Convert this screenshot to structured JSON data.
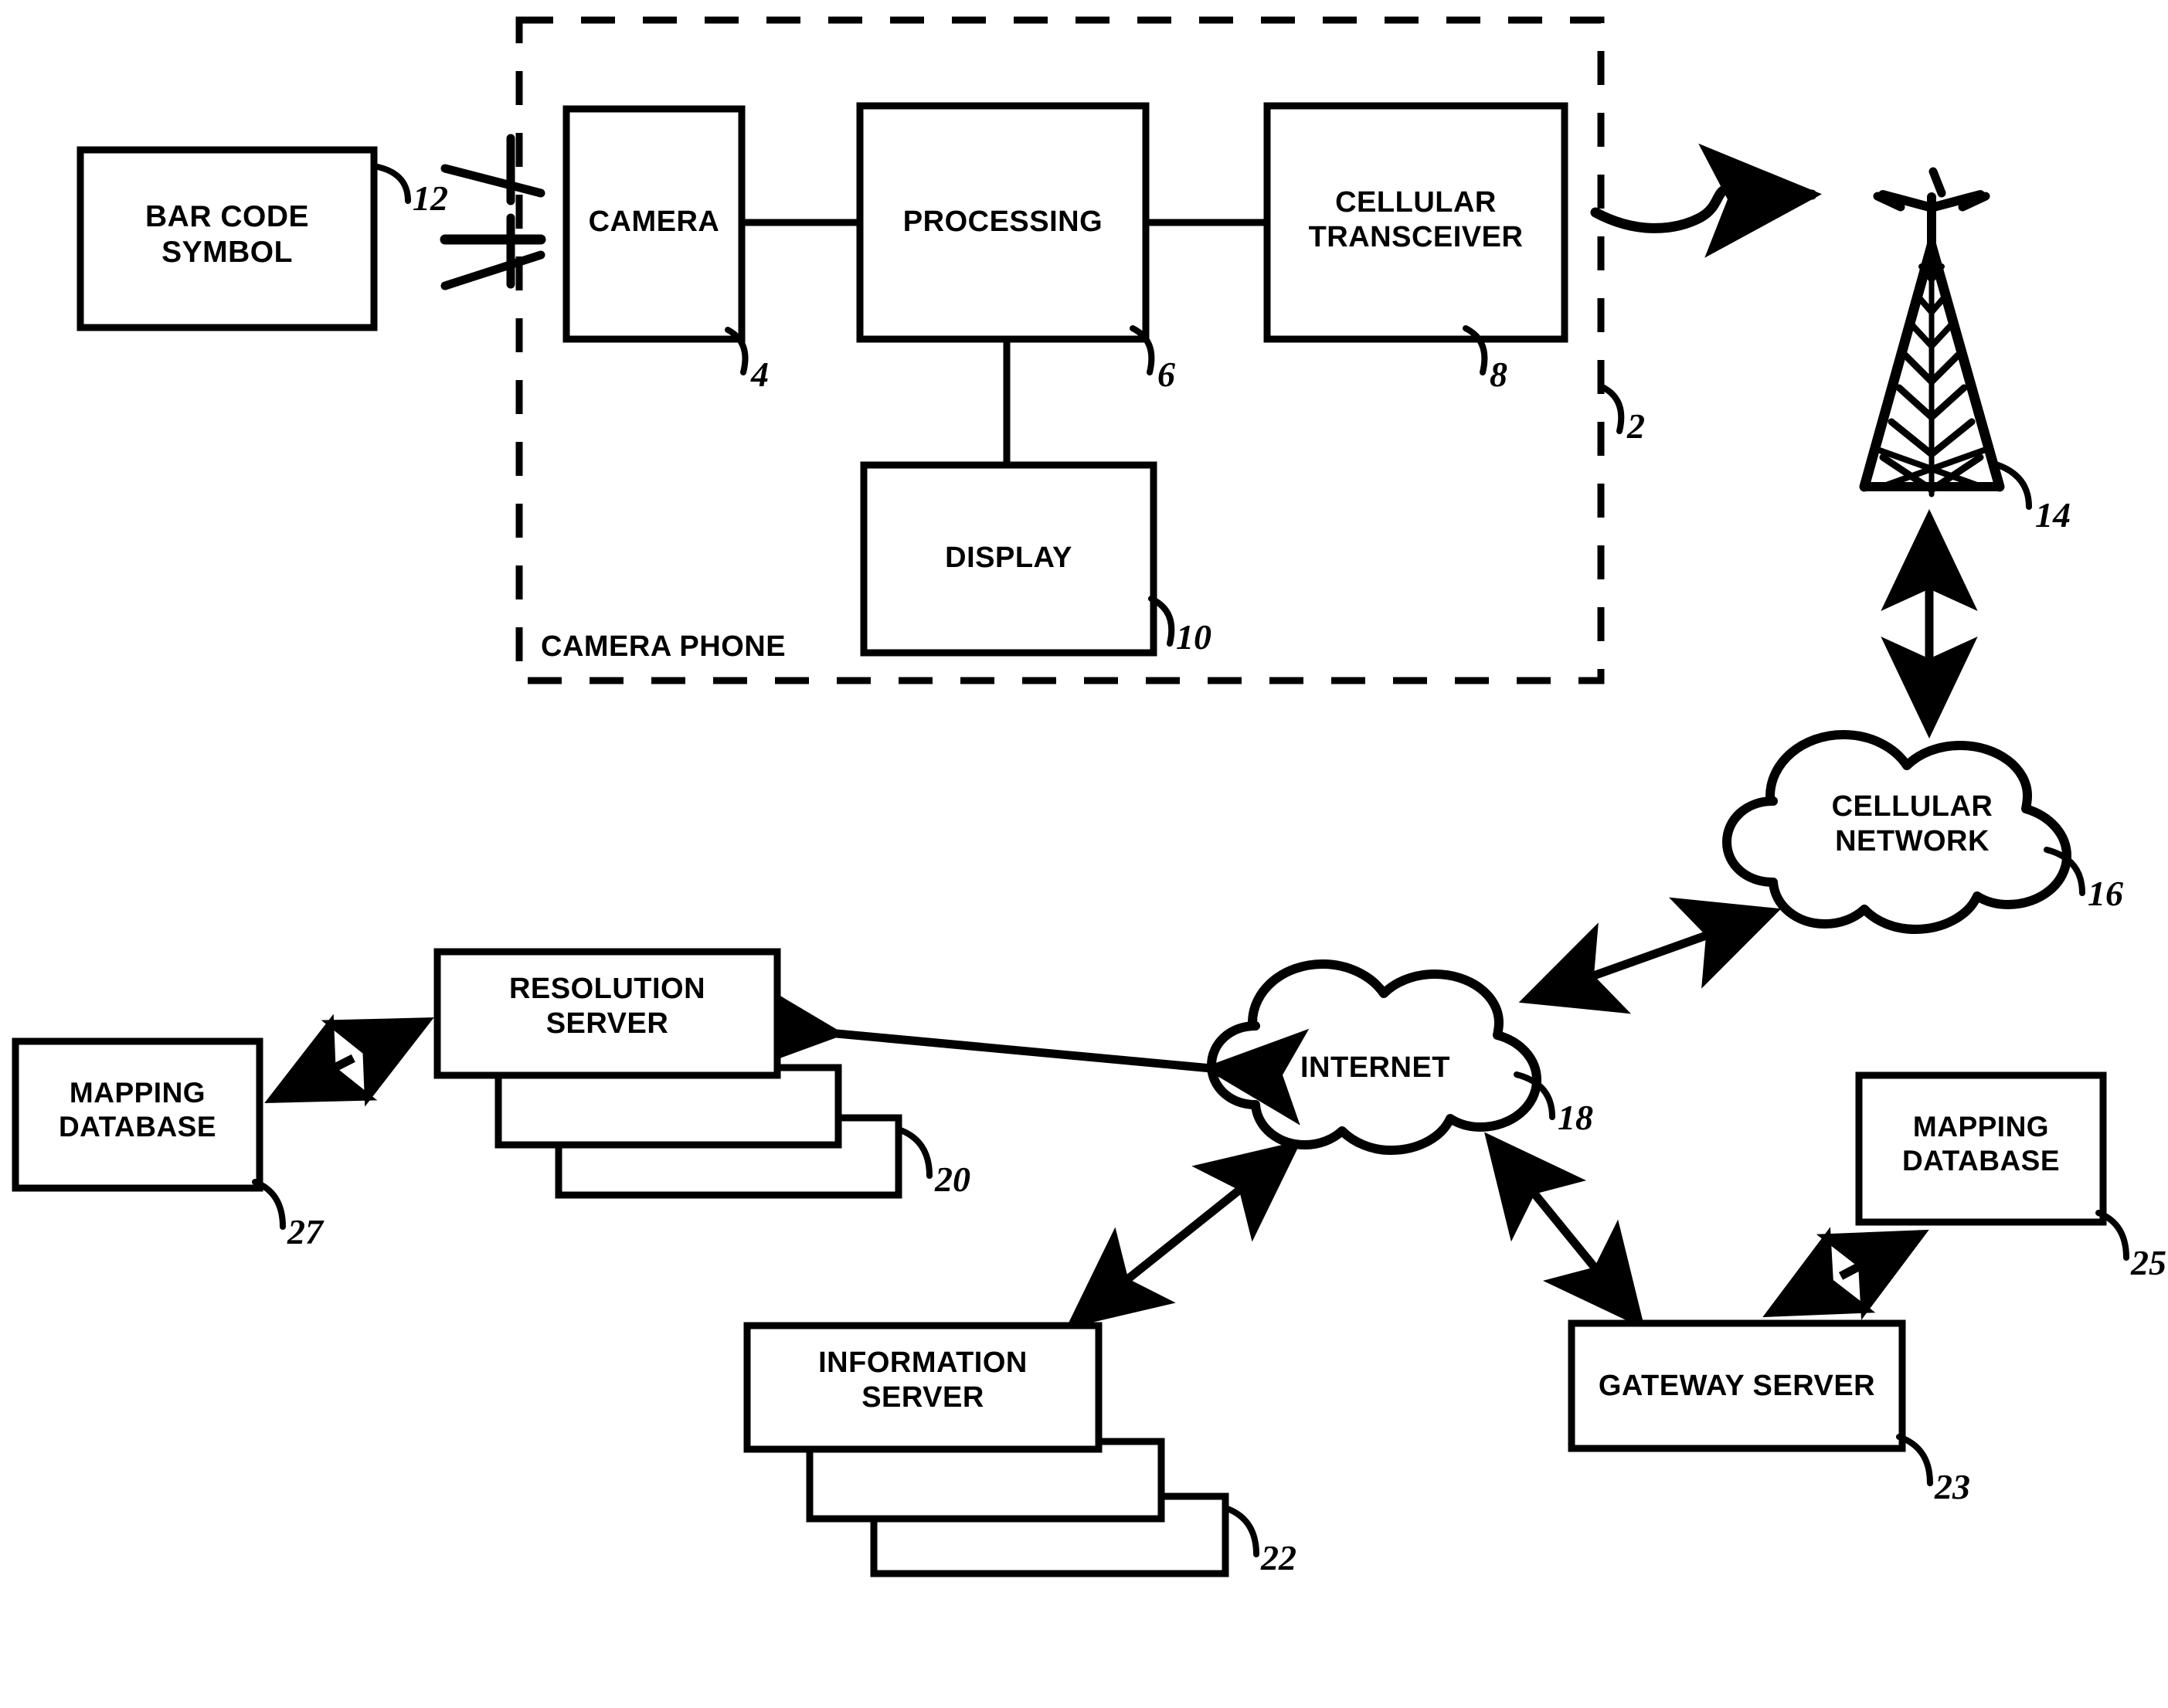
{
  "figure": {
    "enclosure_label": "CAMERA PHONE",
    "line_color": "#000000",
    "background_color": "#ffffff"
  },
  "nodes": {
    "bar_code_symbol": {
      "label": "BAR CODE\nSYMBOL",
      "ref": "12"
    },
    "camera": {
      "label": "CAMERA",
      "ref": "4"
    },
    "processing": {
      "label": "PROCESSING",
      "ref": "6"
    },
    "cellular_transceiver": {
      "label": "CELLULAR\nTRANSCEIVER",
      "ref": "8"
    },
    "display": {
      "label": "DISPLAY",
      "ref": "10"
    },
    "camera_phone": {
      "label": "CAMERA PHONE",
      "ref": "2"
    },
    "cell_tower": {
      "label": "",
      "ref": "14"
    },
    "cellular_network": {
      "label": "CELLULAR\nNETWORK",
      "ref": "16"
    },
    "internet": {
      "label": "INTERNET",
      "ref": "18"
    },
    "resolution_server": {
      "label": "RESOLUTION\nSERVER",
      "ref": "20"
    },
    "information_server": {
      "label": "INFORMATION\nSERVER",
      "ref": "22"
    },
    "gateway_server": {
      "label": "GATEWAY SERVER",
      "ref": "23"
    },
    "mapping_database_left": {
      "label": "MAPPING\nDATABASE",
      "ref": "27"
    },
    "mapping_database_right": {
      "label": "MAPPING\nDATABASE",
      "ref": "25"
    }
  },
  "connections": [
    {
      "from": "bar_code_symbol",
      "to": "camera",
      "style": "optical-path"
    },
    {
      "from": "camera",
      "to": "processing",
      "style": "solid-line"
    },
    {
      "from": "processing",
      "to": "cellular_transceiver",
      "style": "solid-line"
    },
    {
      "from": "processing",
      "to": "display",
      "style": "solid-line"
    },
    {
      "from": "cellular_transceiver",
      "to": "cell_tower",
      "style": "squiggle-arrow"
    },
    {
      "from": "cell_tower",
      "to": "cellular_network",
      "style": "double-arrow"
    },
    {
      "from": "cellular_network",
      "to": "internet",
      "style": "double-arrow"
    },
    {
      "from": "internet",
      "to": "resolution_server",
      "style": "double-arrow"
    },
    {
      "from": "internet",
      "to": "information_server",
      "style": "double-arrow"
    },
    {
      "from": "internet",
      "to": "gateway_server",
      "style": "double-arrow"
    },
    {
      "from": "mapping_database_left",
      "to": "resolution_server",
      "style": "dashed-double-arrow"
    },
    {
      "from": "mapping_database_right",
      "to": "gateway_server",
      "style": "dashed-double-arrow"
    }
  ]
}
